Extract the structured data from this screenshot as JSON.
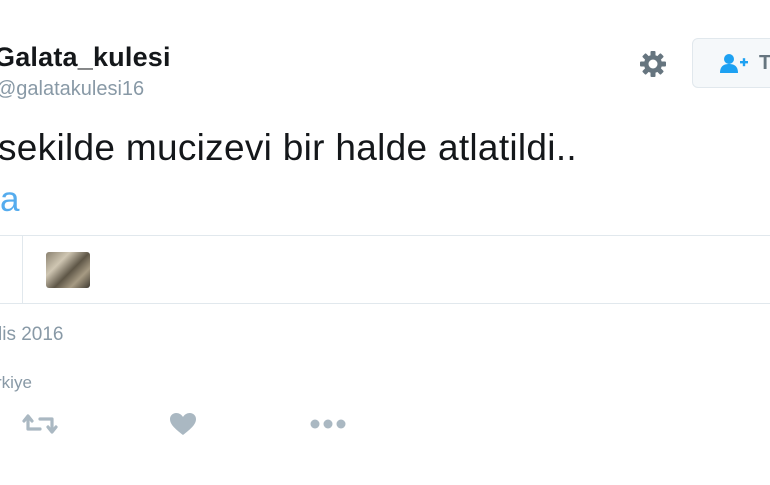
{
  "user": {
    "display_name": "Galata_kulesi",
    "handle": "@galatakulesi16"
  },
  "follow_button": {
    "label": "T",
    "icon": "follow-user-icon"
  },
  "settings": {
    "icon": "gear-icon"
  },
  "tweet": {
    "text": "sekilde mucizevi bir halde atlatildi..",
    "link_fragment": "a"
  },
  "stats": {
    "liker_avatar": "avatar"
  },
  "meta": {
    "date": "lis 2016",
    "location": "rkiye"
  },
  "actions": [
    {
      "icon": "retweet-icon"
    },
    {
      "icon": "heart-icon"
    },
    {
      "icon": "more-icon"
    }
  ],
  "colors": {
    "link": "#55acee",
    "muted": "#8899a6",
    "border": "#e1e8ed",
    "text": "#14171a"
  }
}
